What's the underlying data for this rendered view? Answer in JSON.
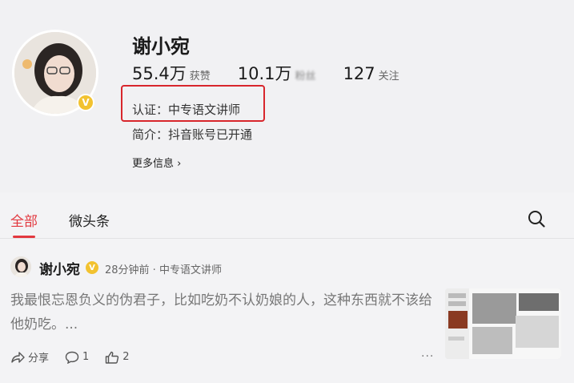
{
  "profile": {
    "name": "谢小宛",
    "stats": [
      {
        "value": "55.4万",
        "label": "获赞"
      },
      {
        "value": "10.1万",
        "label": "粉丝"
      },
      {
        "value": "127",
        "label": "关注"
      }
    ],
    "certification": "认证：中专语文讲师",
    "intro": "简介：抖音账号已开通",
    "more_info": "更多信息"
  },
  "tabs": [
    {
      "label": "全部",
      "active": true
    },
    {
      "label": "微头条",
      "active": false
    }
  ],
  "post": {
    "author": "谢小宛",
    "meta": "28分钟前 · 中专语文讲师",
    "text": "我最恨忘恩负义的伪君子，比如吃奶不认奶娘的人，这种东西就不该给他奶吃。...",
    "share_label": "分享",
    "comment_count": "1",
    "like_count": "2",
    "more": "···"
  },
  "colors": {
    "accent": "#e2383f",
    "highlight_box": "#d8262c",
    "verified": "#f2c230"
  }
}
